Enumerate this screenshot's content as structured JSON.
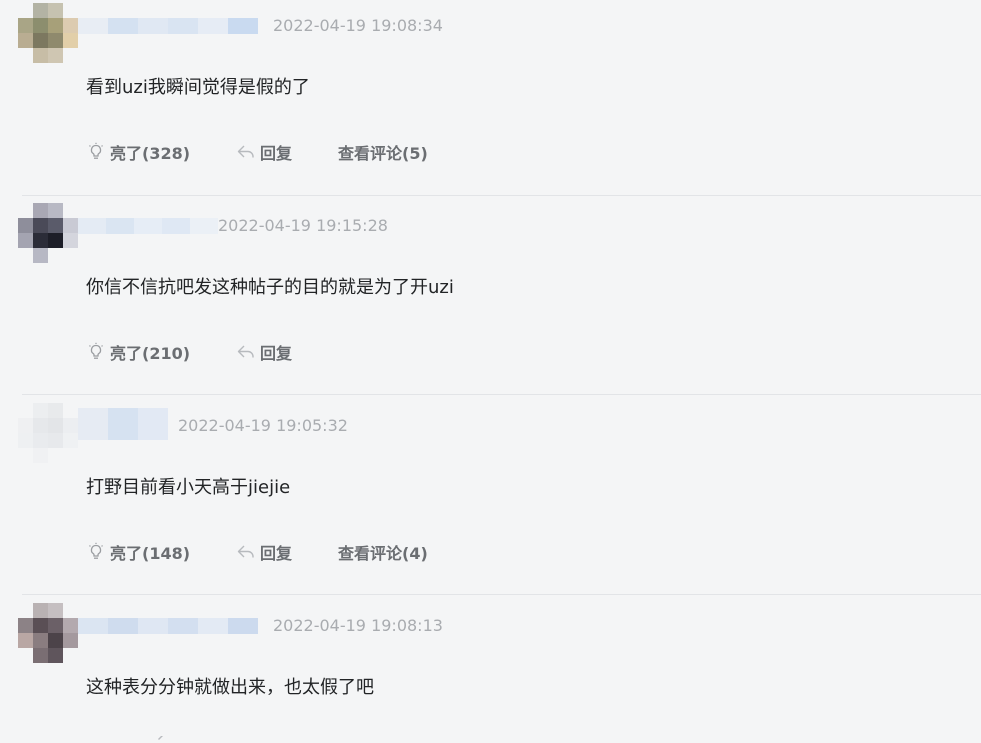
{
  "comments": [
    {
      "timestamp": "2022-04-19 19:08:34",
      "content": "看到uzi我瞬间觉得是假的了",
      "like_label": "亮了(328)",
      "reply_label": "回复",
      "view_replies_label": "查看评论(5)"
    },
    {
      "timestamp": "2022-04-19 19:15:28",
      "content": "你信不信抗吧发这种帖子的目的就是为了开uzi",
      "like_label": "亮了(210)",
      "reply_label": "回复",
      "view_replies_label": ""
    },
    {
      "timestamp": "2022-04-19 19:05:32",
      "content": "打野目前看小天高于jiejie",
      "like_label": "亮了(148)",
      "reply_label": "回复",
      "view_replies_label": "查看评论(4)"
    },
    {
      "timestamp": "2022-04-19 19:08:13",
      "content": "这种表分分钟就做出来，也太假了吧",
      "like_label": "",
      "reply_label": "",
      "view_replies_label": ""
    }
  ],
  "icons": {
    "like": "lightbulb-icon",
    "reply": "reply-arrow-icon"
  },
  "colors": {
    "background": "#f4f5f6",
    "text": "#222426",
    "timestamp": "#a9acb0",
    "action": "#6b6e72",
    "username_blur": "#c9daf0"
  }
}
